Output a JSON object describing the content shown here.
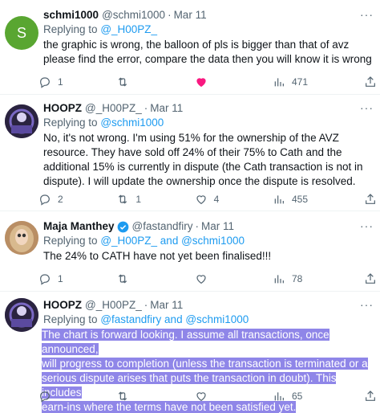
{
  "colors": {
    "link": "#1d9bf0",
    "like": "#f91880",
    "selection": "#8f86e8",
    "muted": "#536471"
  },
  "tweets": [
    {
      "avatar_letter": "S",
      "name": "schmi1000",
      "handle": "@schmi1000",
      "date": "Mar 11",
      "reply_prefix": "Replying to",
      "reply_to": "@_H00PZ_",
      "text": "the graphic is wrong, the balloon of pls is bigger than that of avz please find the error, compare the data then you will know it is wrong",
      "replies": "1",
      "retweets": "",
      "likes": "",
      "views": "471"
    },
    {
      "name": "HOOPZ",
      "handle": "@_H00PZ_",
      "date": "Mar 11",
      "reply_prefix": "Replying to",
      "reply_to": "@schmi1000",
      "text": "No, it's not wrong. I'm using 51% for the ownership of the AVZ resource. They have sold off 24% of their 75% to Cath and the additional 15% is currently in dispute (the Cath transaction is not in dispute). I will update the ownership once the dispute is resolved.",
      "replies": "2",
      "retweets": "1",
      "likes": "4",
      "views": "455"
    },
    {
      "name": "Maja Manthey",
      "handle": "@fastandfiry",
      "date": "Mar 11",
      "reply_prefix": "Replying to",
      "reply_to": "@_H00PZ_ and @schmi1000",
      "text": "The 24% to CATH have not yet been finalised!!!",
      "replies": "1",
      "retweets": "",
      "likes": "",
      "views": "78"
    },
    {
      "name": "HOOPZ",
      "handle": "@_H00PZ_",
      "date": "Mar 11",
      "reply_prefix": "Replying to",
      "reply_to": "@fastandfiry and @schmi1000",
      "text_lines": [
        "The chart is forward looking. I assume all transactions, once announced,",
        "will progress to completion (unless the transaction is terminated or a",
        "serious dispute arises that puts the transaction in doubt). This includes",
        "earn-ins where the terms have not been satisfied yet."
      ],
      "replies": "",
      "retweets": "",
      "likes": "",
      "views": "65"
    }
  ]
}
